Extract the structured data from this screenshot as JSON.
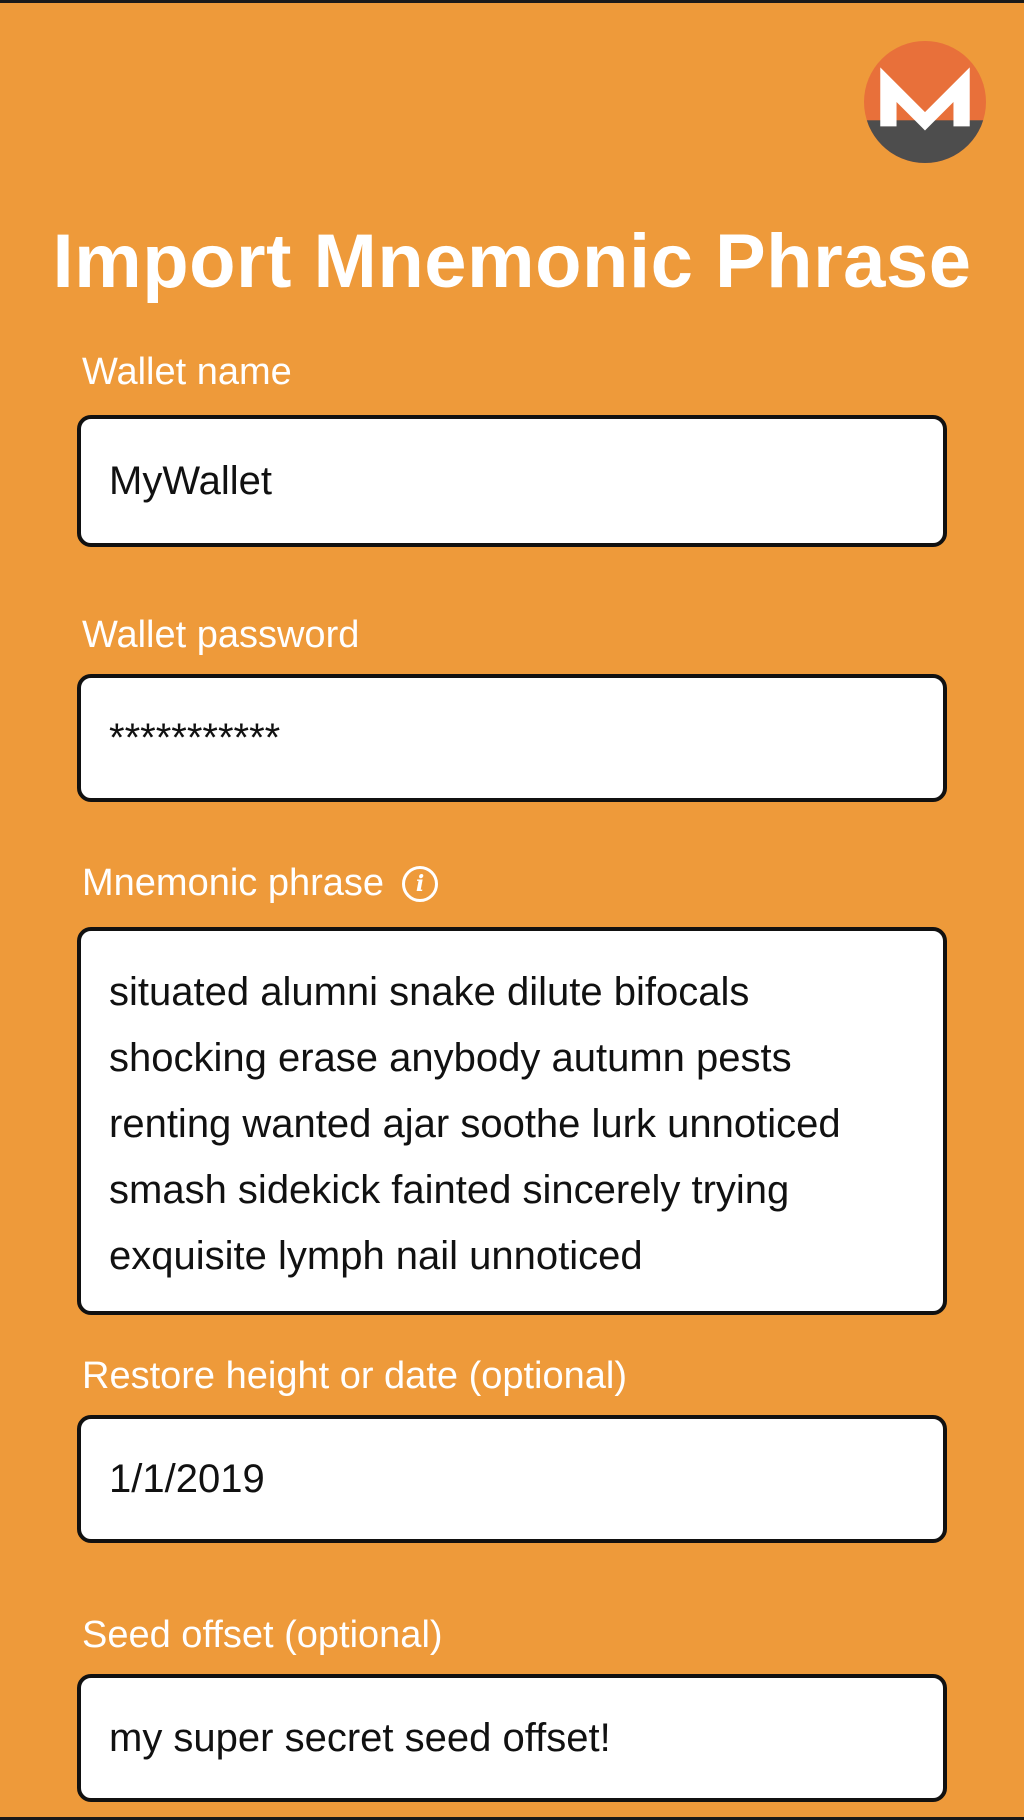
{
  "header": {
    "title": "Import Mnemonic Phrase",
    "logo_icon": "monero-logo"
  },
  "form": {
    "wallet_name": {
      "label": "Wallet name",
      "value": "MyWallet"
    },
    "wallet_password": {
      "label": "Wallet password",
      "value": "***********"
    },
    "mnemonic": {
      "label": "Mnemonic phrase",
      "info_icon": "info-icon",
      "value": "situated alumni snake dilute bifocals\nshocking erase anybody autumn pests\nrenting wanted ajar soothe lurk unnoticed\nsmash sidekick fainted sincerely trying\nexquisite lymph nail unnoticed"
    },
    "restore_height": {
      "label": "Restore height or date (optional)",
      "value": "1/1/2019"
    },
    "seed_offset": {
      "label": "Seed offset (optional)",
      "value": "my super secret seed offset!"
    }
  },
  "colors": {
    "background": "#ee9a3a",
    "logo_orange": "#e8703a",
    "logo_gray": "#4d4d4d"
  }
}
